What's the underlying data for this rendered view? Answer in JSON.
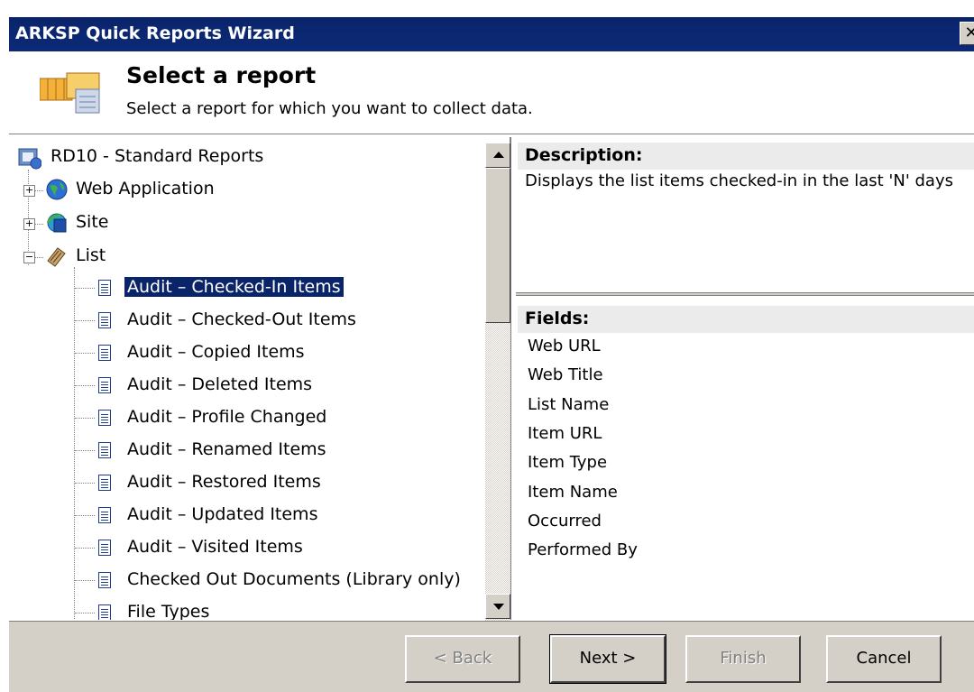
{
  "window": {
    "title": "ARKSP Quick Reports Wizard",
    "close_glyph": "✕"
  },
  "header": {
    "title": "Select a report",
    "subtitle": "Select a report for which you want to collect data.",
    "icon": "report-table-icon"
  },
  "tree": {
    "root": {
      "label": "RD10 - Standard Reports",
      "icon": "computer-reports-icon"
    },
    "groups": [
      {
        "label": "Web Application",
        "icon": "globe-icon",
        "expanded": false
      },
      {
        "label": "Site",
        "icon": "site-icon",
        "expanded": false
      },
      {
        "label": "List",
        "icon": "list-icon",
        "expanded": true
      }
    ],
    "items": [
      {
        "label": "Audit – Checked-In Items",
        "selected": true
      },
      {
        "label": "Audit – Checked-Out Items"
      },
      {
        "label": "Audit – Copied Items"
      },
      {
        "label": "Audit – Deleted Items"
      },
      {
        "label": "Audit – Profile Changed"
      },
      {
        "label": "Audit – Renamed Items"
      },
      {
        "label": "Audit – Restored Items"
      },
      {
        "label": "Audit – Updated Items"
      },
      {
        "label": "Audit – Visited Items"
      },
      {
        "label": "Checked Out Documents (Library only)"
      },
      {
        "label": "File Types"
      }
    ]
  },
  "description": {
    "heading": "Description:",
    "text": "Displays the list items checked-in in the last 'N' days"
  },
  "fields": {
    "heading": "Fields:",
    "items": [
      "Web URL",
      "Web Title",
      "List Name",
      "Item URL",
      "Item Type",
      "Item Name",
      "Occurred",
      "Performed By"
    ]
  },
  "buttons": {
    "back": "< Back",
    "next": "Next >",
    "finish": "Finish",
    "cancel": "Cancel"
  },
  "colors": {
    "title_bar": "#0a246a",
    "selection": "#0a246a",
    "face": "#d4d0c8"
  }
}
